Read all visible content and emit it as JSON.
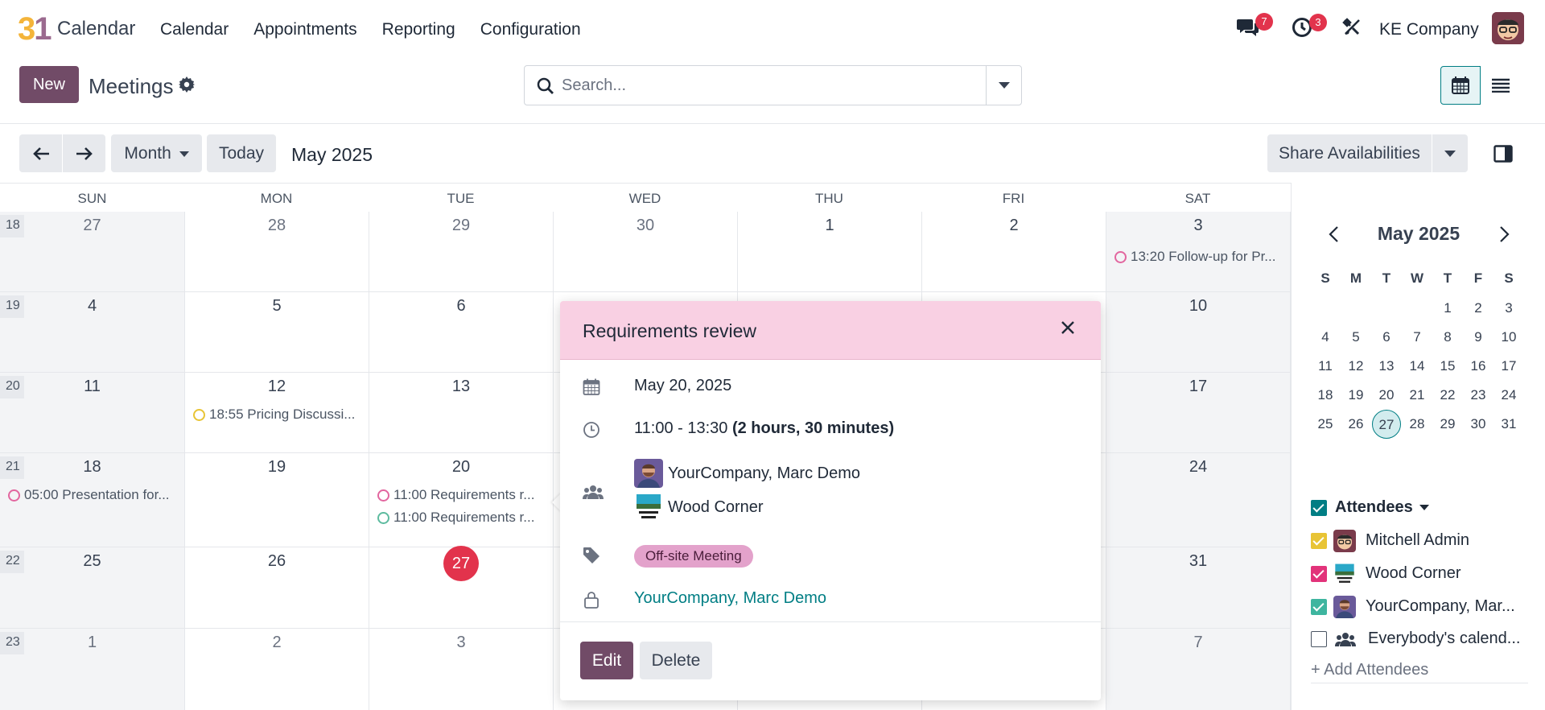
{
  "app": {
    "logo_digit_1": "3",
    "logo_digit_2": "1",
    "name": "Calendar"
  },
  "nav": {
    "items": [
      "Calendar",
      "Appointments",
      "Reporting",
      "Configuration"
    ],
    "messages_count": "7",
    "activities_count": "3",
    "company": "KE Company"
  },
  "control": {
    "new_label": "New",
    "title": "Meetings",
    "search_placeholder": "Search..."
  },
  "toolbar": {
    "scale_label": "Month",
    "today_label": "Today",
    "range_title": "May 2025",
    "share_label": "Share Availabilities"
  },
  "calendar": {
    "weekdays": [
      "SUN",
      "MON",
      "TUE",
      "WED",
      "THU",
      "FRI",
      "SAT"
    ],
    "weeks": [
      {
        "num": "18",
        "days": [
          "27",
          "28",
          "29",
          "30",
          "1",
          "2",
          "3"
        ]
      },
      {
        "num": "19",
        "days": [
          "4",
          "5",
          "6",
          "",
          "",
          "",
          "10"
        ]
      },
      {
        "num": "20",
        "days": [
          "11",
          "12",
          "13",
          "",
          "",
          "",
          "17"
        ]
      },
      {
        "num": "21",
        "days": [
          "18",
          "19",
          "20",
          "",
          "",
          "",
          "24"
        ]
      },
      {
        "num": "22",
        "days": [
          "25",
          "26",
          "27",
          "",
          "",
          "",
          "31"
        ]
      },
      {
        "num": "23",
        "days": [
          "1",
          "2",
          "3",
          "",
          "",
          "",
          "7"
        ]
      }
    ],
    "events": [
      {
        "text": "13:20 Follow-up for Pr...",
        "color": "#e2669f"
      },
      {
        "text": "18:55 Pricing Discussi...",
        "color": "#e8c435"
      },
      {
        "text": "05:00 Presentation for...",
        "color": "#e2669f"
      },
      {
        "text": "11:00 Requirements r...",
        "color": "#e2669f"
      },
      {
        "text": "11:00 Requirements r...",
        "color": "#5dbb9f"
      }
    ]
  },
  "popover": {
    "title": "Requirements review",
    "date": "May 20, 2025",
    "time": "11:00 - 13:30",
    "duration": "(2 hours, 30 minutes)",
    "attendees": [
      "YourCompany, Marc Demo",
      "Wood Corner"
    ],
    "tag": "Off-site Meeting",
    "organizer": "YourCompany, Marc Demo",
    "edit_label": "Edit",
    "delete_label": "Delete"
  },
  "mini_calendar": {
    "title": "May 2025",
    "dow": [
      "S",
      "M",
      "T",
      "W",
      "T",
      "F",
      "S"
    ],
    "weeks": [
      [
        "",
        "",
        "",
        "",
        "1",
        "2",
        "3"
      ],
      [
        "4",
        "5",
        "6",
        "7",
        "8",
        "9",
        "10"
      ],
      [
        "11",
        "12",
        "13",
        "14",
        "15",
        "16",
        "17"
      ],
      [
        "18",
        "19",
        "20",
        "21",
        "22",
        "23",
        "24"
      ],
      [
        "25",
        "26",
        "27",
        "28",
        "29",
        "30",
        "31"
      ]
    ],
    "today": "27"
  },
  "filters": {
    "section_label": "Attendees",
    "items": [
      {
        "label": "Mitchell Admin",
        "color": "#e8c435",
        "checked": true
      },
      {
        "label": "Wood Corner",
        "color": "#e2337a",
        "checked": true
      },
      {
        "label": "YourCompany, Mar...",
        "color": "#3eb59f",
        "checked": true
      },
      {
        "label": "Everybody's calend...",
        "color": "#ffffff",
        "checked": false
      }
    ],
    "add_label": "+ Add Attendees"
  },
  "colors": {
    "brand": "#714b67",
    "teal": "#017e84",
    "today": "#e2334c",
    "popover_header": "#f9d0e3"
  }
}
